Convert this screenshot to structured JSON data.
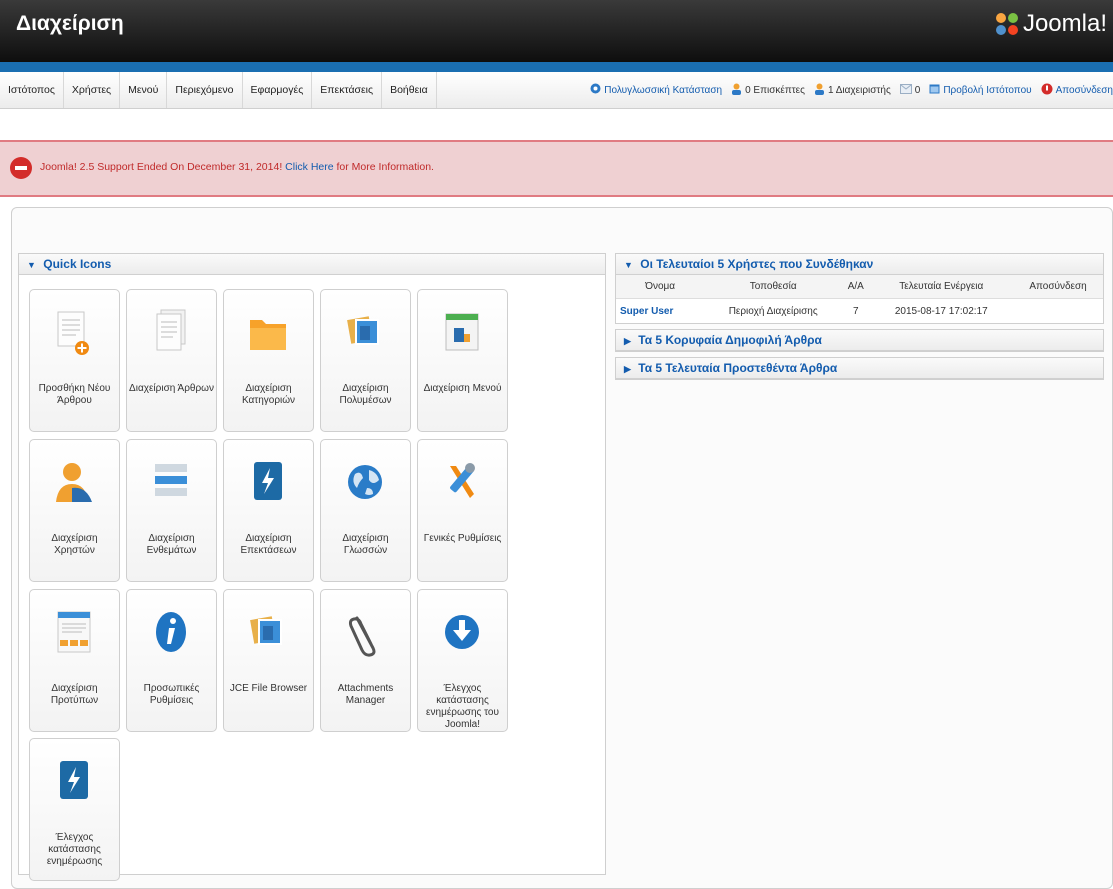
{
  "header": {
    "title": "Διαχείριση",
    "logo_text": "Joomla!"
  },
  "menu": {
    "items": [
      "Ιστότοπος",
      "Χρήστες",
      "Μενού",
      "Περιεχόμενο",
      "Εφαρμογές",
      "Επεκτάσεις",
      "Βοήθεια"
    ]
  },
  "status": {
    "multilingual": "Πολυγλωσσική Κατάσταση",
    "visitors": "0 Επισκέπτες",
    "admins": "1 Διαχειριστής",
    "messages": "0",
    "view_site": "Προβολή Ιστότοπου",
    "logout": "Αποσύνδεση"
  },
  "alert": {
    "text": "Joomla! 2.5 Support Ended On December 31, 2014!",
    "link": "Click Here",
    "suffix": "for More Information."
  },
  "quick_icons": {
    "title": "Quick Icons",
    "items": [
      {
        "label": "Προσθήκη Νέου Άρθρου",
        "icon": "article-add-icon"
      },
      {
        "label": "Διαχείριση Άρθρων",
        "icon": "article-icon"
      },
      {
        "label": "Διαχείριση Κατηγοριών",
        "icon": "category-folder-icon"
      },
      {
        "label": "Διαχείριση Πολυμέσων",
        "icon": "media-icon"
      },
      {
        "label": "Διαχείριση Μενού",
        "icon": "menu-icon"
      },
      {
        "label": "Διαχείριση Χρηστών",
        "icon": "user-icon"
      },
      {
        "label": "Διαχείριση Ενθεμάτων",
        "icon": "module-icon"
      },
      {
        "label": "Διαχείριση Επεκτάσεων",
        "icon": "extension-icon"
      },
      {
        "label": "Διαχείριση Γλωσσών",
        "icon": "language-globe-icon"
      },
      {
        "label": "Γενικές Ρυθμίσεις",
        "icon": "config-tools-icon"
      },
      {
        "label": "Διαχείριση Προτύπων",
        "icon": "template-icon"
      },
      {
        "label": "Προσωπικές Ρυθμίσεις",
        "icon": "info-icon"
      },
      {
        "label": "JCE File Browser",
        "icon": "file-browser-icon"
      },
      {
        "label": "Attachments Manager",
        "icon": "paperclip-icon"
      },
      {
        "label": "Έλεγχος κατάστασης ενημέρωσης του Joomla!",
        "icon": "download-update-icon"
      },
      {
        "label": "Έλεγχος κατάστασης ενημέρωσης",
        "icon": "extension-update-icon"
      }
    ]
  },
  "logged_users": {
    "title": "Οι Τελευταίοι 5 Χρήστες που Συνδέθηκαν",
    "columns": [
      "Όνομα",
      "Τοποθεσία",
      "Α/Α",
      "Τελευταία Ενέργεια",
      "Αποσύνδεση"
    ],
    "rows": [
      [
        "Super User",
        "Περιοχή Διαχείρισης",
        "7",
        "2015-08-17 17:02:17",
        ""
      ]
    ]
  },
  "popular": {
    "title": "Τα 5 Κορυφαία Δημοφιλή Άρθρα"
  },
  "latest": {
    "title": "Τα 5 Τελευταία Προστεθέντα Άρθρα"
  },
  "colors": {
    "accent": "#135cae",
    "alert_bg": "#efd0d2",
    "alert_text": "#c02a2a"
  }
}
